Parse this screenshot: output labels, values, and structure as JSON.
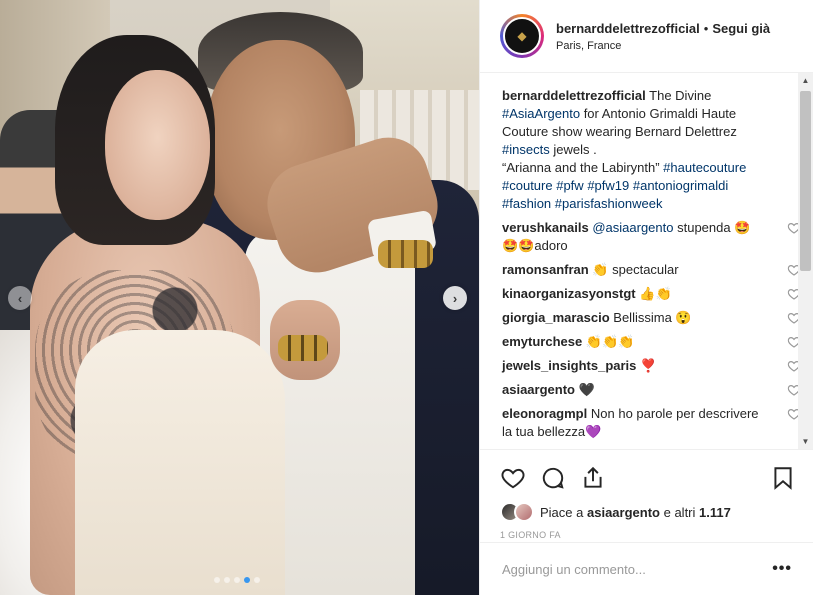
{
  "header": {
    "username": "bernarddelettrezofficial",
    "separator": "•",
    "follow_state": "Segui già",
    "location": "Paris, France"
  },
  "caption": {
    "username": "bernarddelettrezofficial",
    "text_1": "The Divine",
    "mention": "#AsiaArgento",
    "text_2": "for Antonio Grimaldi Haute Couture show wearing Bernard Delettrez",
    "tag_insects": "#insects",
    "text_3": "jewels .",
    "text_4": "“Arianna and the Labirynth”",
    "tags_line": [
      "#hautecouture",
      "#couture",
      "#pfw",
      "#pfw19",
      "#antoniogrimaldi",
      "#fashion",
      "#parisfashionweek"
    ]
  },
  "comments": [
    {
      "user": "verushkanails",
      "mention": "@asiaargento",
      "text": "stupenda 🤩🤩🤩adoro"
    },
    {
      "user": "ramonsanfran",
      "mention": "",
      "text": "👏 spectacular"
    },
    {
      "user": "kinaorganizasyonstgt",
      "mention": "",
      "text": "👍👏"
    },
    {
      "user": "giorgia_marascio",
      "mention": "",
      "text": "Bellissima 😲"
    },
    {
      "user": "emyturchese",
      "mention": "",
      "text": "👏👏👏"
    },
    {
      "user": "jewels_insights_paris",
      "mention": "",
      "text": "❣️"
    },
    {
      "user": "asiaargento",
      "mention": "",
      "text": "🖤"
    },
    {
      "user": "eleonoragmpl",
      "mention": "",
      "text": "Non ho parole per descrivere la tua bellezza💜"
    }
  ],
  "actions": {
    "likes_prefix": "Piace a",
    "likes_user": "asiaargento",
    "likes_middle": "e altri",
    "likes_count": "1.117",
    "time_ago": "1 GIORNO FA"
  },
  "add_comment": {
    "placeholder": "Aggiungi un commento...",
    "more_label": "•••"
  },
  "carousel": {
    "total_slides": 5,
    "active_slide": 4
  },
  "colors": {
    "tag": "#003569",
    "active_dot": "#3897f0",
    "text": "#262626",
    "muted": "#999999"
  },
  "icons": [
    "chevron-left-icon",
    "chevron-right-icon",
    "heart-icon",
    "comment-icon",
    "share-icon",
    "bookmark-icon",
    "more-icon"
  ]
}
